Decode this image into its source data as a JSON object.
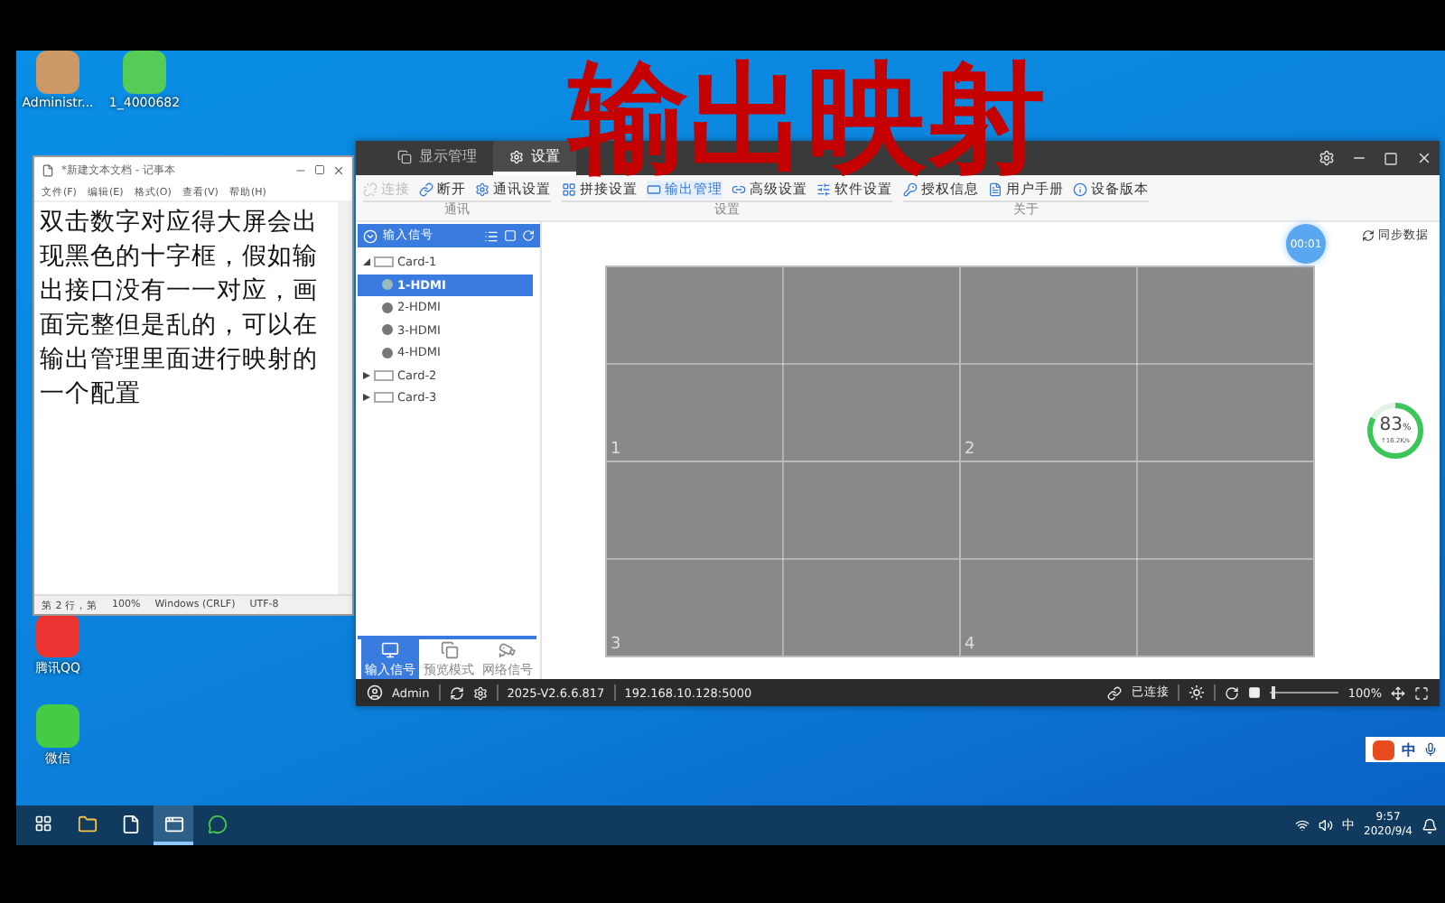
{
  "overlay_title": "输出映射",
  "desktop_icons": [
    {
      "label": "Administr..."
    },
    {
      "label": "1_4000682"
    },
    {
      "label": "腾讯QQ"
    },
    {
      "label": "微信"
    }
  ],
  "notepad": {
    "title": "*新建文本文档 - 记事本",
    "menu": [
      "文件(F)",
      "编辑(E)",
      "格式(O)",
      "查看(V)",
      "帮助(H)"
    ],
    "text": "双击数字对应得大屏会出现黑色的十字框，假如输出接口没有一一对应，画面完整但是乱的，可以在输出管理里面进行映射的一个配置",
    "status": [
      "第 2 行，第",
      "100%",
      "Windows (CRLF)",
      "UTF-8"
    ]
  },
  "app": {
    "tabs": [
      {
        "label": "显示管理",
        "selected": false
      },
      {
        "label": "设置",
        "selected": true
      }
    ],
    "toolbar_groups": [
      {
        "label": "通讯",
        "items": [
          {
            "label": "连接",
            "disabled": true,
            "selected": false
          },
          {
            "label": "断开",
            "disabled": false,
            "selected": false
          },
          {
            "label": "通讯设置",
            "disabled": false,
            "selected": false
          }
        ]
      },
      {
        "label": "设置",
        "items": [
          {
            "label": "拼接设置",
            "disabled": false,
            "selected": false
          },
          {
            "label": "输出管理",
            "disabled": false,
            "selected": true
          },
          {
            "label": "高级设置",
            "disabled": false,
            "selected": false
          },
          {
            "label": "软件设置",
            "disabled": false,
            "selected": false
          }
        ]
      },
      {
        "label": "关于",
        "items": [
          {
            "label": "授权信息",
            "disabled": false,
            "selected": false
          },
          {
            "label": "用户手册",
            "disabled": false,
            "selected": false
          },
          {
            "label": "设备版本",
            "disabled": false,
            "selected": false
          }
        ]
      }
    ],
    "panel": {
      "title": "输入信号",
      "tree": [
        {
          "label": "Card-1",
          "expanded": true,
          "selected": false,
          "children": [
            {
              "label": "1-HDMI",
              "selected": true
            },
            {
              "label": "2-HDMI",
              "selected": false
            },
            {
              "label": "3-HDMI",
              "selected": false
            },
            {
              "label": "4-HDMI",
              "selected": false
            }
          ]
        },
        {
          "label": "Card-2",
          "expanded": false,
          "selected": false
        },
        {
          "label": "Card-3",
          "expanded": false,
          "selected": false
        }
      ],
      "bottom_tabs": [
        {
          "label": "输入信号",
          "selected": true
        },
        {
          "label": "预览模式",
          "selected": false
        },
        {
          "label": "网络信号",
          "selected": false
        }
      ]
    },
    "canvas": {
      "timer": "00:01",
      "sync": "同步数据",
      "screens": [
        "1",
        "2",
        "3",
        "4"
      ],
      "ring": {
        "level": 0.83,
        "value": "83",
        "unit": "%",
        "rate": "↑16.2K/s"
      }
    },
    "status": {
      "user": "Admin",
      "version": "2025-V2.6.6.817",
      "address": "192.168.10.128:5000",
      "connection": "已连接",
      "zoom_slider": {
        "level": 0.02
      },
      "zoom": "100%"
    }
  },
  "ime": {
    "label": "中"
  },
  "taskbar": {
    "language": "中",
    "time": "9:57",
    "date": "2020/9/4"
  }
}
